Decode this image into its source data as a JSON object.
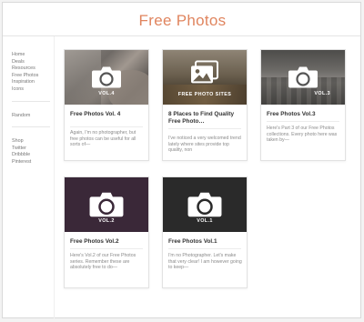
{
  "site": {
    "title": "Free Photos"
  },
  "sidebar": {
    "group1": [
      "Home",
      "Deals",
      "Resources",
      "Free Photos",
      "Inspiration",
      "Icons"
    ],
    "group2": [
      "Random"
    ],
    "group3": [
      "Shop",
      "Twitter",
      "Dribbble",
      "Pinterest"
    ]
  },
  "cards": [
    {
      "thumb_label": "VOL.4",
      "title": "Free Photos Vol. 4",
      "excerpt": "Again, I'm no photographer, but free photos can be useful for all sorts of—"
    },
    {
      "thumb_label": "FREE PHOTO SITES",
      "title": "8 Places to Find Quality Free Photo…",
      "excerpt": "I've noticed a very welcomed trend lately where sites provide top quality, non"
    },
    {
      "thumb_label": "VOL.3",
      "title": "Free Photos Vol.3",
      "excerpt": "Here's Part 3 of our Free Photos collections. Every photo here was taken by—"
    },
    {
      "thumb_label": "VOL.2",
      "title": "Free Photos Vol.2",
      "excerpt": "Here's Vol.2 of our Free Photos series. Remember these are absolutely free to do—"
    },
    {
      "thumb_label": "VOL.1",
      "title": "Free Photos Vol.1",
      "excerpt": "I'm no Photographer. Let's make that very clear! I am however going to keep—"
    }
  ],
  "colors": {
    "accent": "#e0855f"
  },
  "icons": {
    "card_thumb": "camera-icon",
    "card_thumb_sites": "photos-icon"
  }
}
